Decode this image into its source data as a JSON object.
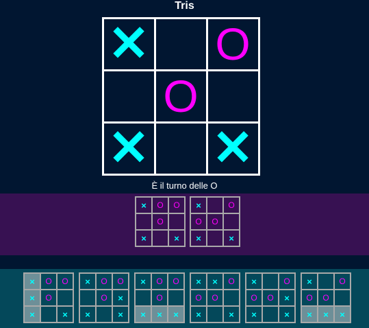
{
  "game": {
    "title": "Tris",
    "status": "È il turno delle O",
    "board": [
      "X",
      "",
      "O",
      "",
      "O",
      "",
      "X",
      "",
      "X"
    ],
    "colors": {
      "x": "#00ffff",
      "o": "#ff00ff",
      "background": "#011631"
    }
  },
  "candidates": [
    {
      "board": [
        "X",
        "O",
        "O",
        "",
        "O",
        "",
        "X",
        "",
        "X"
      ]
    },
    {
      "board": [
        "X",
        "",
        "O",
        "O",
        "O",
        "",
        "X",
        "",
        "X"
      ]
    }
  ],
  "history": [
    {
      "board": [
        "X",
        "O",
        "O",
        "X",
        "O",
        "",
        "X",
        "",
        "X"
      ],
      "highlight": [
        0,
        3,
        6
      ]
    },
    {
      "board": [
        "X",
        "O",
        "O",
        "",
        "O",
        "X",
        "X",
        "",
        "X"
      ],
      "highlight": []
    },
    {
      "board": [
        "X",
        "O",
        "O",
        "",
        "O",
        "",
        "X",
        "X",
        "X"
      ],
      "highlight": [
        6,
        7,
        8
      ]
    },
    {
      "board": [
        "X",
        "X",
        "O",
        "O",
        "O",
        "",
        "X",
        "",
        "X"
      ],
      "highlight": []
    },
    {
      "board": [
        "X",
        "",
        "O",
        "O",
        "O",
        "X",
        "X",
        "",
        "X"
      ],
      "highlight": []
    },
    {
      "board": [
        "X",
        "",
        "O",
        "O",
        "O",
        "",
        "X",
        "X",
        "X"
      ],
      "highlight": [
        6,
        7,
        8
      ]
    }
  ]
}
